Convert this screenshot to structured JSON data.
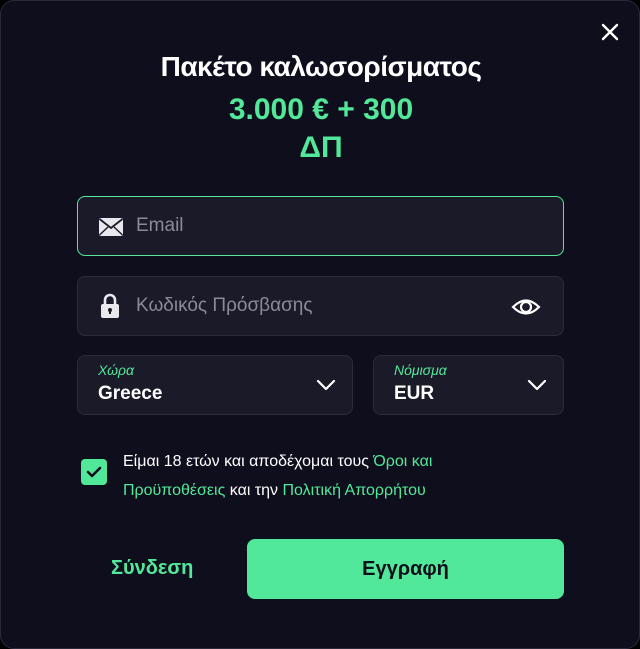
{
  "modal": {
    "title": "Πακέτο καλωσορίσματος",
    "offer_line1": "3.000 € + 300",
    "offer_line2": "ΔΠ"
  },
  "form": {
    "email_placeholder": "Email",
    "password_placeholder": "Κωδικός Πρόσβασης",
    "country": {
      "label": "Χώρα",
      "value": "Greece"
    },
    "currency": {
      "label": "Νόμισμα",
      "value": "EUR"
    },
    "terms": {
      "text_before": "Είμαι 18 ετών και αποδέχομαι τους ",
      "terms_link": "Όροι και Προϋποθέσεις",
      "text_middle": " και την ",
      "privacy_link": "Πολιτική Απορρήτου",
      "checked": true
    }
  },
  "actions": {
    "login_label": "Σύνδεση",
    "register_label": "Εγγραφή"
  },
  "icons": {
    "close": "close-icon",
    "email": "envelope-icon",
    "password": "lock-icon",
    "show_password": "eye-icon",
    "dropdown": "chevron-down-icon",
    "check": "checkmark-icon"
  },
  "colors": {
    "accent": "#52e89a",
    "background": "#0f0e1c",
    "field": "#1b1a28"
  }
}
